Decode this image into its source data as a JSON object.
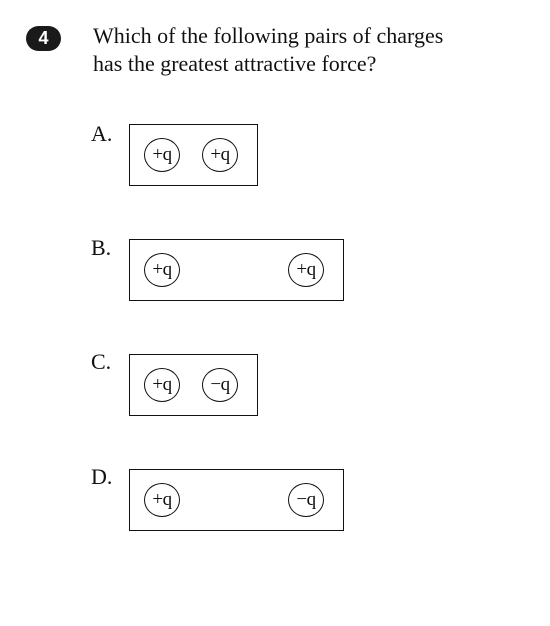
{
  "question": {
    "number": "4",
    "line1": "Which of the following pairs of charges",
    "line2": "has the greatest attractive force?"
  },
  "options": [
    {
      "letter": "A.",
      "left_charge": "+q",
      "right_charge": "+q"
    },
    {
      "letter": "B.",
      "left_charge": "+q",
      "right_charge": "+q"
    },
    {
      "letter": "C.",
      "left_charge": "+q",
      "right_charge": "−q"
    },
    {
      "letter": "D.",
      "left_charge": "+q",
      "right_charge": "−q"
    }
  ]
}
